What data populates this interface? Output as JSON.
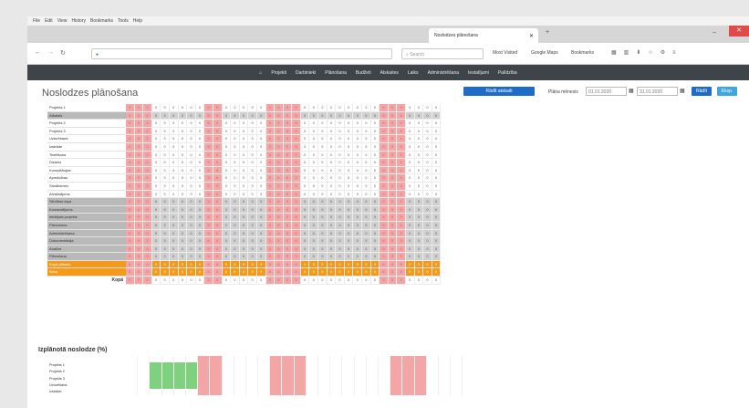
{
  "browser": {
    "menu": [
      "File",
      "Edit",
      "View",
      "History",
      "Bookmarks",
      "Tools",
      "Help"
    ],
    "tab_label": "Noslodzes plānošana",
    "search_placeholder": "Search",
    "bookmarks": [
      "Most Visited",
      "Google Maps",
      "Bookmarks"
    ]
  },
  "nav": {
    "items": [
      "Projekti",
      "Darbinieki",
      "Plānošana",
      "Budžeti",
      "Atskaites",
      "Laiks",
      "Administrēšana",
      "Iestatījumi",
      "Palīdzība"
    ]
  },
  "page": {
    "title": "Noslodzes plānošana",
    "primary_button": "Rādīt atskaiti",
    "period_label": "Plāna mēnesis",
    "date_from": "01.01.2020",
    "date_to": "31.01.2020",
    "btn_show": "Rādīt",
    "btn_export": "Eksp."
  },
  "grid": {
    "rows": [
      {
        "name": "Projekts 1",
        "style": "normal"
      },
      {
        "name": "Atbalsts",
        "style": "gray"
      },
      {
        "name": "Projekts 2",
        "style": "normal"
      },
      {
        "name": "Projekts 3",
        "style": "normal"
      },
      {
        "name": "Uzturēšana",
        "style": "normal"
      },
      {
        "name": "Izstrāde",
        "style": "normal"
      },
      {
        "name": "Testēšana",
        "style": "normal"
      },
      {
        "name": "Dizains",
        "style": "normal"
      },
      {
        "name": "Konsultācijas",
        "style": "normal"
      },
      {
        "name": "Apmācības",
        "style": "normal"
      },
      {
        "name": "Sanāksmes",
        "style": "normal"
      },
      {
        "name": "Atvaļinājums",
        "style": "normal"
      },
      {
        "name": "Slimības lapa",
        "style": "gray"
      },
      {
        "name": "Komandējums",
        "style": "gray"
      },
      {
        "name": "Iekšējais projekts",
        "style": "gray"
      },
      {
        "name": "Pārdošana",
        "style": "gray"
      },
      {
        "name": "Administrēšana",
        "style": "gray"
      },
      {
        "name": "Dokumentācija",
        "style": "gray"
      },
      {
        "name": "Analīze",
        "style": "gray"
      },
      {
        "name": "Plānošana",
        "style": "gray"
      },
      {
        "name": "Kopā plānots",
        "style": "orange"
      },
      {
        "name": "Brīvs",
        "style": "orange"
      }
    ],
    "total_label": "Kopā",
    "cell_value": "0"
  },
  "stats": {
    "heading": "Izplānotā noslodze (%)",
    "rows": [
      "Projekts 1",
      "Projekts 2",
      "Projekts 3",
      "Uzturēšana",
      "Izstrāde"
    ]
  }
}
